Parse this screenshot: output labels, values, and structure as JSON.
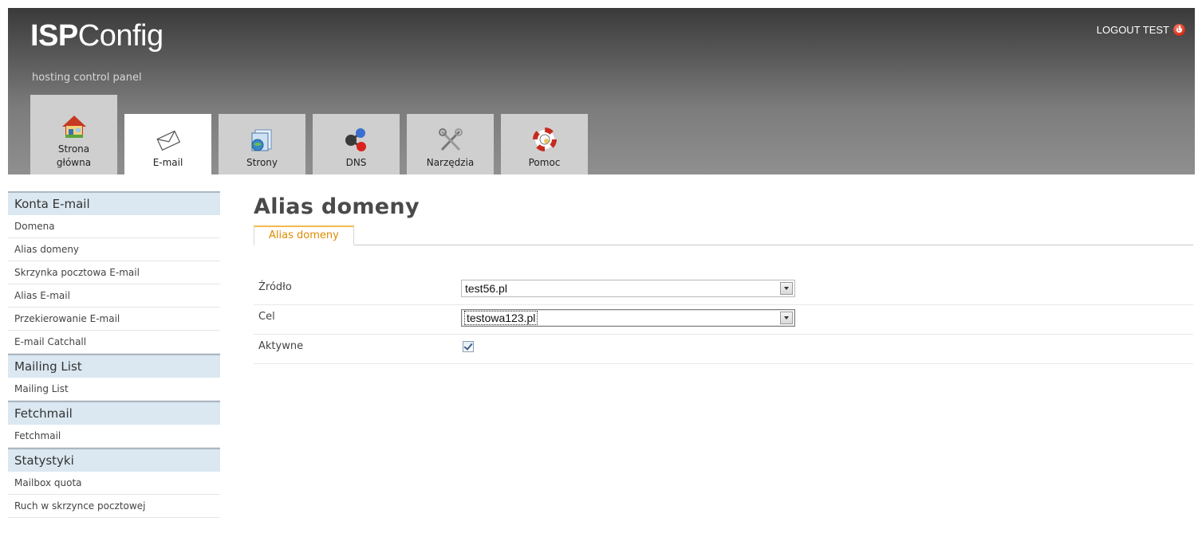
{
  "header": {
    "logo_bold": "ISP",
    "logo_rest": "Config",
    "slogan": "hosting control panel",
    "logout_label": "LOGOUT TEST"
  },
  "tabs": [
    {
      "label": "Strona\ngłówna",
      "icon": "home-icon",
      "active": false
    },
    {
      "label": "E-mail",
      "icon": "envelope-icon",
      "active": true
    },
    {
      "label": "Strony",
      "icon": "website-icon",
      "active": false
    },
    {
      "label": "DNS",
      "icon": "dns-molecule-icon",
      "active": false
    },
    {
      "label": "Narzędzia",
      "icon": "tools-icon",
      "active": false
    },
    {
      "label": "Pomoc",
      "icon": "lifebuoy-icon",
      "active": false
    }
  ],
  "sidebar": {
    "sections": [
      {
        "title": "Konta E-mail",
        "items": [
          "Domena",
          "Alias domeny",
          "Skrzynka pocztowa E-mail",
          "Alias E-mail",
          "Przekierowanie E-mail",
          "E-mail Catchall"
        ]
      },
      {
        "title": "Mailing List",
        "items": [
          "Mailing List"
        ]
      },
      {
        "title": "Fetchmail",
        "items": [
          "Fetchmail"
        ]
      },
      {
        "title": "Statystyki",
        "items": [
          "Mailbox quota",
          "Ruch w skrzynce pocztowej"
        ]
      }
    ]
  },
  "content": {
    "title": "Alias domeny",
    "subtab": "Alias domeny",
    "fields": {
      "source_label": "Źródło",
      "source_value": "test56.pl",
      "target_label": "Cel",
      "target_value": "testowa123.pl",
      "active_label": "Aktywne",
      "active_checked": true
    }
  },
  "colors": {
    "subtab_text": "#e08a00",
    "sidebar_section_bg": "#dbe8f1",
    "header_dark": "#3a3a3a"
  }
}
